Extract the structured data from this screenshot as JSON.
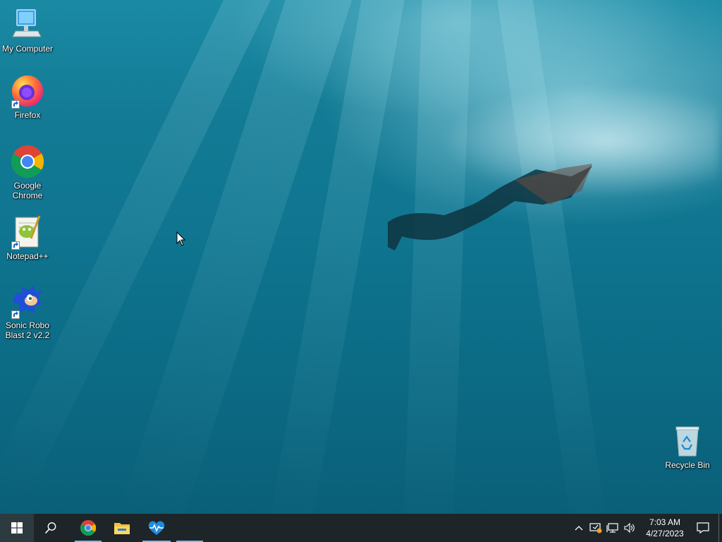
{
  "desktop": {
    "icons": [
      {
        "label": "My Computer",
        "icon": "computer-icon"
      },
      {
        "label": "Firefox",
        "icon": "firefox-icon"
      },
      {
        "label": "Google Chrome",
        "icon": "chrome-icon"
      },
      {
        "label": "Notepad++",
        "icon": "notepadpp-icon"
      },
      {
        "label": "Sonic Robo Blast 2 v2.2",
        "icon": "sonic-icon"
      },
      {
        "label": "Recycle Bin",
        "icon": "recycle-bin-icon"
      }
    ]
  },
  "taskbar": {
    "pinned": [
      {
        "name": "Google Chrome",
        "icon": "chrome-icon"
      },
      {
        "name": "File Explorer",
        "icon": "folder-icon"
      },
      {
        "name": "Activity Monitor",
        "icon": "heartbeat-icon"
      }
    ],
    "clock": {
      "time": "7:03 AM",
      "date": "4/27/2023"
    }
  },
  "colors": {
    "taskbar": "#1d2529",
    "accent": "#76b9ed"
  }
}
